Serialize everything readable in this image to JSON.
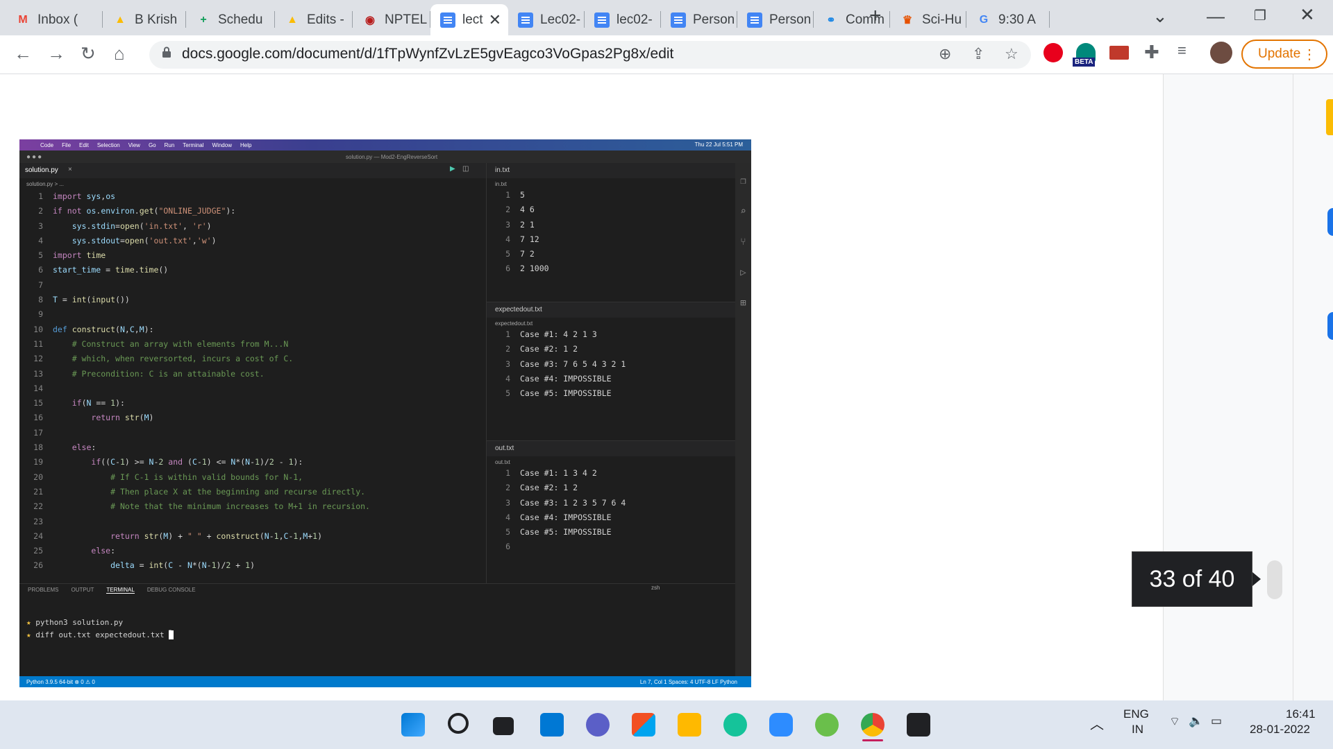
{
  "tabs": [
    {
      "label": "Inbox (",
      "icon": "gmail-icon"
    },
    {
      "label": "B Krish",
      "icon": "drive-icon"
    },
    {
      "label": "Schedu",
      "icon": "sheets-icon"
    },
    {
      "label": "Edits -",
      "icon": "drive-icon"
    },
    {
      "label": "NPTEL",
      "icon": "nptel-icon"
    },
    {
      "label": "lect",
      "icon": "docs-icon",
      "active": true
    },
    {
      "label": "Lec02-",
      "icon": "docs-icon"
    },
    {
      "label": "lec02-",
      "icon": "docs-icon"
    },
    {
      "label": "Person",
      "icon": "docs-icon"
    },
    {
      "label": "Person",
      "icon": "docs-icon"
    },
    {
      "label": "Comm",
      "icon": "link-icon"
    },
    {
      "label": "Sci-Hu",
      "icon": "scihub-icon"
    },
    {
      "label": "9:30 A",
      "icon": "google-icon"
    }
  ],
  "url": "docs.google.com/document/d/1fTpWynfZvLzE5gvEagco3VoGpas2Pg8x/edit",
  "update_label": "Update",
  "beta_label": "BETA",
  "slide_counter": "33 of 40",
  "vscode": {
    "menubar": [
      "Code",
      "File",
      "Edit",
      "Selection",
      "View",
      "Go",
      "Run",
      "Terminal",
      "Window",
      "Help"
    ],
    "clock": "Thu 22 Jul 5:51 PM",
    "window_title": "solution.py — Mod2-EngReverseSort",
    "editor_tab": "solution.py",
    "breadcrumb": "solution.py > ...",
    "code_lines": [
      "import sys,os",
      "if not os.environ.get(\"ONLINE_JUDGE\"):",
      "    sys.stdin=open('in.txt', 'r')",
      "    sys.stdout=open('out.txt','w')",
      "import time",
      "start_time = time.time()",
      "",
      "T = int(input())",
      "",
      "def construct(N,C,M):",
      "    # Construct an array with elements from M...N",
      "    # which, when reversorted, incurs a cost of C.",
      "    # Precondition: C is an attainable cost.",
      "",
      "    if(N == 1):",
      "        return str(M)",
      "",
      "    else:",
      "        if((C-1) >= N-2 and (C-1) <= N*(N-1)/2 - 1):",
      "            # If C-1 is within valid bounds for N-1,",
      "            # Then place X at the beginning and recurse directly.",
      "            # Note that the minimum increases to M+1 in recursion.",
      "",
      "            return str(M) + \" \" + construct(N-1,C-1,M+1)",
      "        else:",
      "            delta = int(C - N*(N-1)/2 + 1)"
    ],
    "in_file": {
      "tab": "in.txt",
      "crumb": "in.txt",
      "lines": [
        "5",
        "4 6",
        "2 1",
        "7 12",
        "7 2",
        "2 1000"
      ]
    },
    "expected_file": {
      "tab": "expectedout.txt",
      "crumb": "expectedout.txt",
      "lines": [
        "Case #1: 4 2 1 3",
        "Case #2: 1 2",
        "Case #3: 7 6 5 4 3 2 1",
        "Case #4: IMPOSSIBLE",
        "Case #5: IMPOSSIBLE"
      ]
    },
    "out_file": {
      "tab": "out.txt",
      "crumb": "out.txt",
      "lines": [
        "Case #1: 1 3 4 2",
        "Case #2: 1 2",
        "Case #3: 1 2 3 5 7 6 4",
        "Case #4: IMPOSSIBLE",
        "Case #5: IMPOSSIBLE",
        ""
      ]
    },
    "panel_tabs": [
      "PROBLEMS",
      "OUTPUT",
      "TERMINAL",
      "DEBUG CONSOLE"
    ],
    "terminal_shell": "zsh",
    "terminal_lines": [
      "python3 solution.py",
      "diff out.txt expectedout.txt"
    ],
    "status_left": "Python 3.9.5 64-bit   ⊗ 0 ⚠ 0",
    "status_right": "Ln 7, Col 1   Spaces: 4   UTF-8   LF   Python"
  },
  "taskbar": {
    "lang_top": "ENG",
    "lang_bottom": "IN",
    "time": "16:41",
    "date": "28-01-2022"
  }
}
